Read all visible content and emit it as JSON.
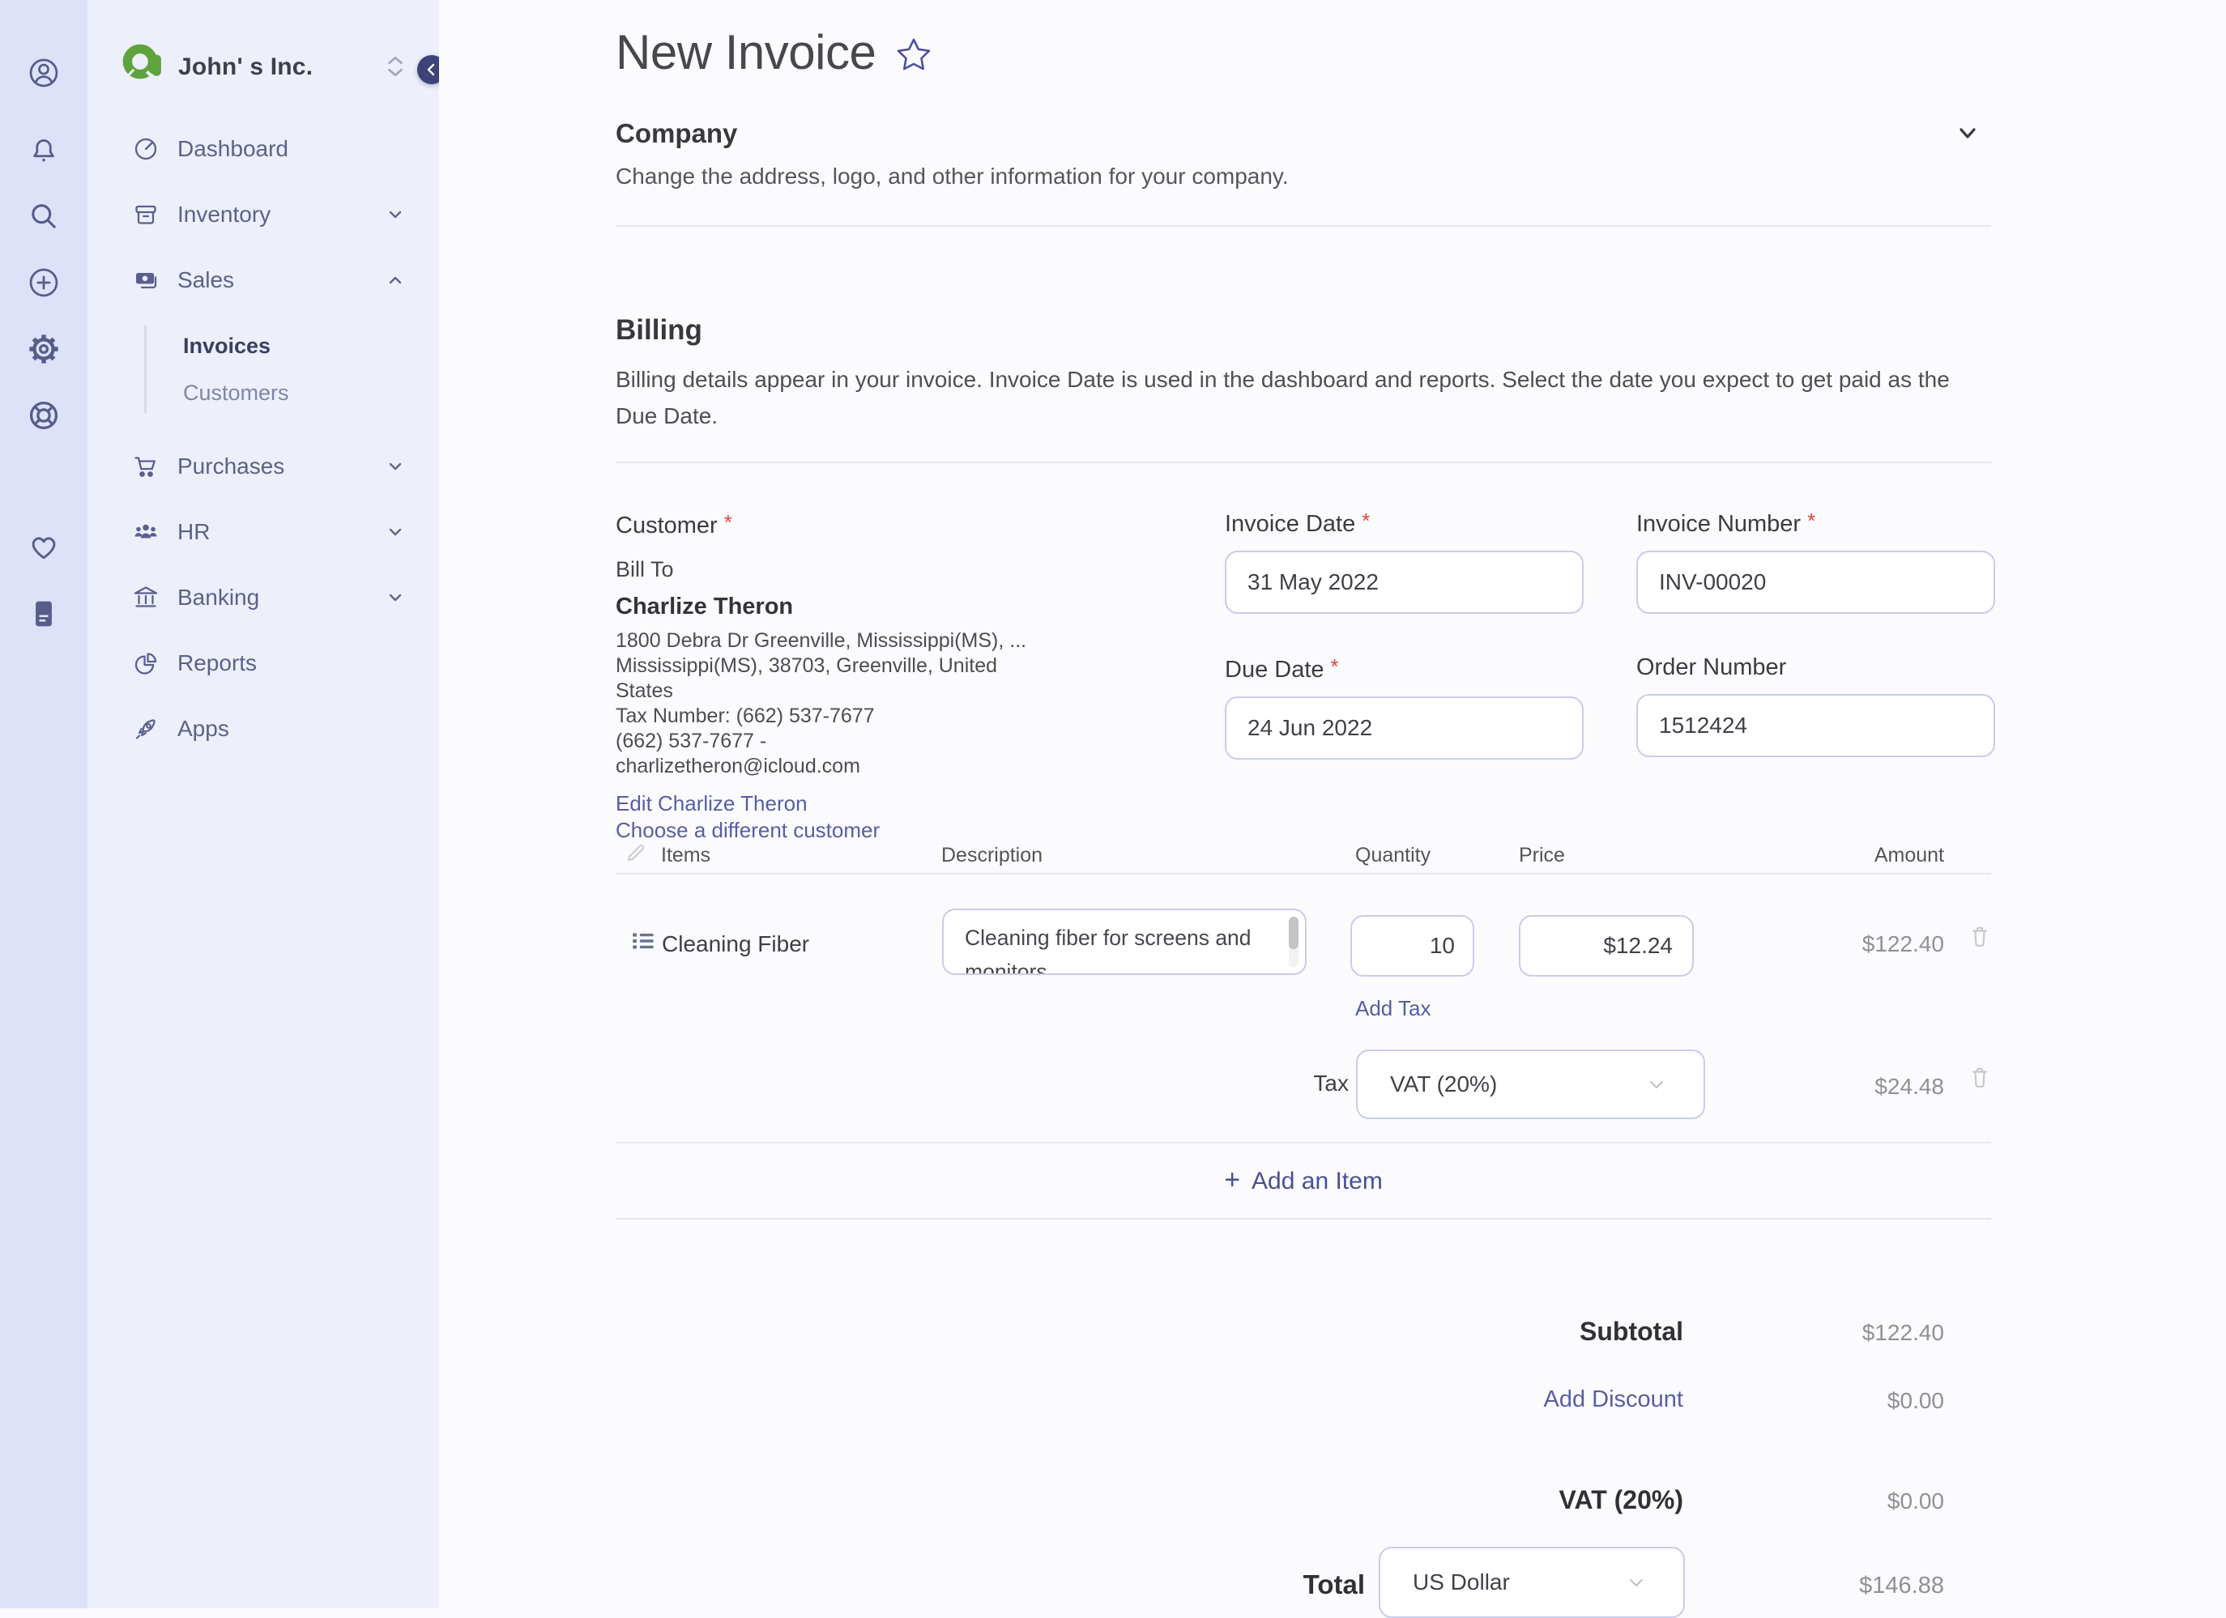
{
  "colors": {
    "accent_link": "#585da3",
    "logo_green": "#5fa33c",
    "rail_background": "#dee2f8",
    "sidebar_background": "#edeffa",
    "main_background": "#fbfbfe",
    "required_mark_color": "#e04545",
    "collapse_button": "#3d4377"
  },
  "rail": {
    "icons": [
      "account",
      "notifications",
      "search",
      "add-new",
      "settings",
      "support",
      "favorites",
      "documents"
    ]
  },
  "sidebar": {
    "company_name": "John' s Inc.",
    "items": [
      {
        "label": "Dashboard",
        "icon": "dashboard"
      },
      {
        "label": "Inventory",
        "icon": "inventory",
        "chevron": "down"
      },
      {
        "label": "Sales",
        "icon": "sales",
        "chevron": "up"
      },
      {
        "label": "Purchases",
        "icon": "purchases",
        "chevron": "down"
      },
      {
        "label": "HR",
        "icon": "hr",
        "chevron": "down"
      },
      {
        "label": "Banking",
        "icon": "banking",
        "chevron": "down"
      },
      {
        "label": "Reports",
        "icon": "reports"
      },
      {
        "label": "Apps",
        "icon": "apps"
      }
    ],
    "sales_children": [
      {
        "label": "Invoices",
        "active": true
      },
      {
        "label": "Customers",
        "active": false
      }
    ]
  },
  "page": {
    "title": "New Invoice",
    "required_mark": "*",
    "company": {
      "heading": "Company",
      "description": "Change the address, logo, and other information for your company."
    },
    "billing": {
      "heading": "Billing",
      "description": "Billing details appear in your invoice. Invoice Date is used in the dashboard and reports. Select the date you expect to get paid as the Due Date."
    },
    "customer": {
      "label": "Customer",
      "bill_to": "Bill To",
      "name": "Charlize Theron",
      "address_line1": "1800 Debra Dr Greenville, Mississippi(MS),  ...",
      "address_line2": "Mississippi(MS), 38703, Greenville, United",
      "address_line3": "States",
      "tax_line": "Tax Number: (662) 537-7677",
      "phone_line": "(662) 537-7677   -",
      "email": "charlizetheron@icloud.com",
      "edit_link": "Edit Charlize Theron",
      "choose_link": "Choose a different customer"
    },
    "fields": {
      "invoice_date": {
        "label": "Invoice Date",
        "value": "31 May 2022",
        "required": true
      },
      "invoice_number": {
        "label": "Invoice Number",
        "value": "INV-00020",
        "required": true
      },
      "due_date": {
        "label": "Due Date",
        "value": "24 Jun 2022",
        "required": true
      },
      "order_number": {
        "label": "Order Number",
        "value": "1512424",
        "required": false
      }
    },
    "items_table": {
      "headers": {
        "items": "Items",
        "description": "Description",
        "quantity": "Quantity",
        "price": "Price",
        "amount": "Amount"
      },
      "row": {
        "name": "Cleaning Fiber",
        "description": "Cleaning fiber for screens and monitors",
        "quantity": "10",
        "price": "$12.24",
        "amount": "$122.40"
      },
      "add_tax_label": "Add Tax",
      "tax": {
        "label": "Tax",
        "selected_option": "VAT (20%)",
        "amount": "$24.48"
      },
      "add_item_plus": "+",
      "add_item_label": "Add an Item"
    },
    "totals": {
      "subtotal": {
        "label": "Subtotal",
        "value": "$122.40"
      },
      "discount": {
        "label": "Add Discount",
        "value": "$0.00"
      },
      "vat": {
        "label": "VAT (20%)",
        "value": "$0.00"
      },
      "total": {
        "label": "Total",
        "currency": "US Dollar",
        "value": "$146.88"
      }
    }
  }
}
